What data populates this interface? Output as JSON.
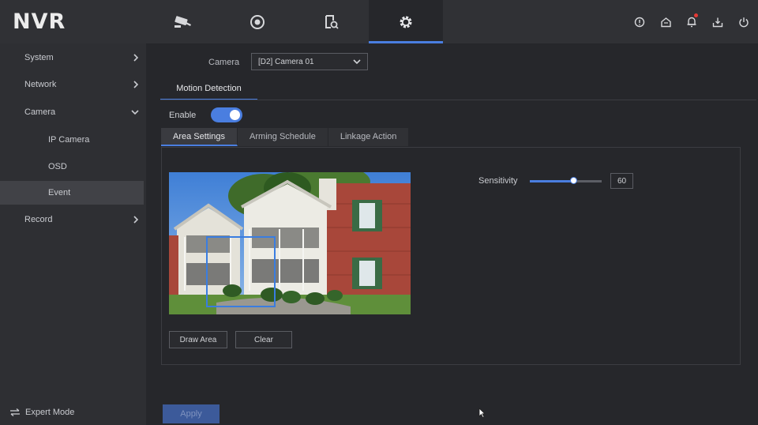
{
  "app": {
    "title": "NVR"
  },
  "nav": {
    "tabs": [
      {
        "icon": "camera-icon",
        "active": false
      },
      {
        "icon": "playback-icon",
        "active": false
      },
      {
        "icon": "search-icon",
        "active": false
      },
      {
        "icon": "settings-icon",
        "active": true
      }
    ],
    "right_icons": [
      "info-icon",
      "home-icon",
      "notification-icon",
      "download-icon",
      "power-icon"
    ]
  },
  "sidebar": {
    "items": [
      {
        "label": "System",
        "expandable": true
      },
      {
        "label": "Network",
        "expandable": true
      },
      {
        "label": "Camera",
        "expandable": true,
        "expanded": true
      },
      {
        "label": "IP Camera"
      },
      {
        "label": "OSD"
      },
      {
        "label": "Event",
        "active": true
      },
      {
        "label": "Record",
        "expandable": true
      }
    ],
    "footer": "Expert Mode"
  },
  "main": {
    "camera_label": "Camera",
    "camera_value": "[D2] Camera 01",
    "section_tab": "Motion Detection",
    "enable_label": "Enable",
    "enable_on": true,
    "sub_tabs": [
      {
        "label": "Area Settings",
        "active": true
      },
      {
        "label": "Arming Schedule",
        "active": false
      },
      {
        "label": "Linkage Action",
        "active": false
      }
    ],
    "draw_area_label": "Draw Area",
    "clear_label": "Clear",
    "sensitivity_label": "Sensitivity",
    "sensitivity_value": "60",
    "sensitivity_fraction": 0.6,
    "apply_label": "Apply"
  },
  "colors": {
    "accent": "#4a7ee0",
    "background": "#26272b",
    "sidebar": "#2e2f33"
  }
}
